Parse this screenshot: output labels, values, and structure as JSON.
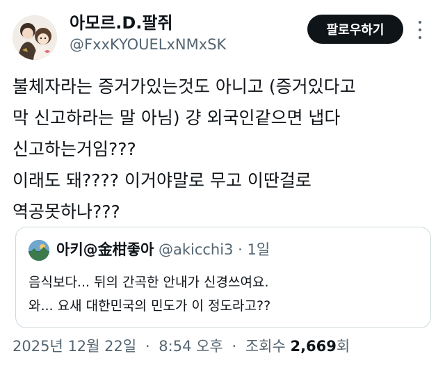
{
  "author": {
    "display_name": "아모르.D.팔쥐",
    "handle": "@FxxKYOUELxNMxSK",
    "follow_label": "팔로우하기"
  },
  "body_lines": [
    "불체자라는 증거가있는것도 아니고 (증거있다고",
    "막 신고하라는 말 아님) 걍 외국인같으면 냅다",
    "신고하는거임???",
    "이래도 돼???? 이거야말로 무고 이딴걸로",
    "역공못하나???"
  ],
  "quoted_tweet": {
    "display_name": "아키@金柑좋아",
    "handle": "@akicchi3",
    "separator": "·",
    "time": "1일",
    "lines": [
      "음식보다... 뒤의 간곡한 안내가 신경쓰여요.",
      "와... 요새 대한민국의 민도가 이 정도라고??"
    ]
  },
  "meta": {
    "date": "2025년 12월 22일",
    "separator": "·",
    "time": "8:54 오후",
    "views_label": "조회수",
    "views_count": "2,669",
    "views_suffix": "회"
  },
  "colors": {
    "text": "#0f1419",
    "secondary": "#536471",
    "border": "#cfd9de",
    "follow_bg": "#0f1419"
  }
}
